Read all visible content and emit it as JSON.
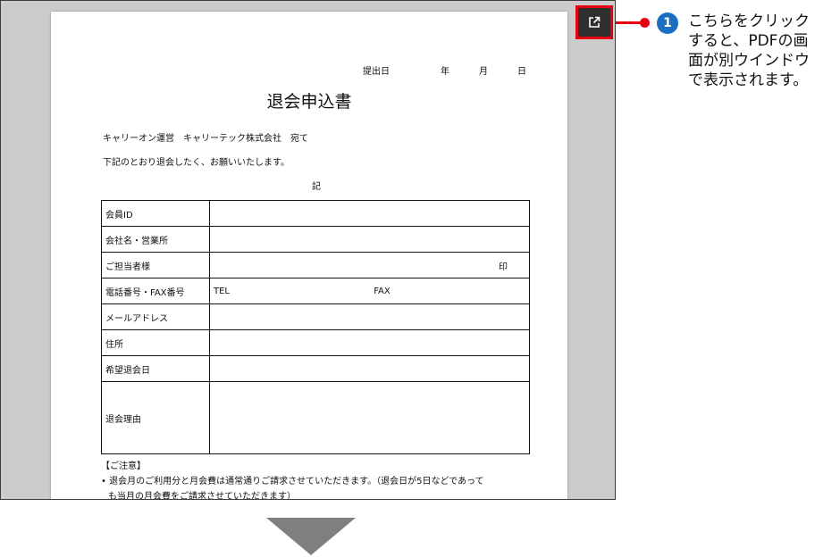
{
  "form": {
    "date_label": "提出日",
    "year_label": "年",
    "month_label": "月",
    "day_label": "日",
    "title": "退会申込書",
    "addressee": "キャリーオン運営　キャリーテック株式会社　宛て",
    "intro": "下記のとおり退会したく、お願いいたします。",
    "ki": "記",
    "rows": [
      {
        "label": "会員ID",
        "value": ""
      },
      {
        "label": "会社名・営業所",
        "value": ""
      },
      {
        "label": "ご担当者様",
        "value": "",
        "seal": "印"
      },
      {
        "label": "電話番号・FAX番号",
        "tel": "TEL",
        "fax": "FAX"
      },
      {
        "label": "メールアドレス",
        "value": ""
      },
      {
        "label": "住所",
        "value": ""
      },
      {
        "label": "希望退会日",
        "value": ""
      },
      {
        "label": "退会理由",
        "value": ""
      }
    ],
    "notes_heading": "【ご注意】",
    "notes_line1": "• 退会月のご利用分と月会費は通常通りご請求させていただきます。（退会日が5日などであって",
    "notes_line2": "も当月の月会費をご請求させていただきます）"
  },
  "annotation": {
    "step_number": "1",
    "lines": [
      "こちらをクリック",
      "すると、PDFの画",
      "面が別ウインドウ",
      "で表示されます。"
    ],
    "highlight_color": "#e60012",
    "badge_color": "#1a6fc0"
  },
  "icons": {
    "open_external": "open-in-new-window-icon",
    "next_step": "down-arrow-icon"
  }
}
